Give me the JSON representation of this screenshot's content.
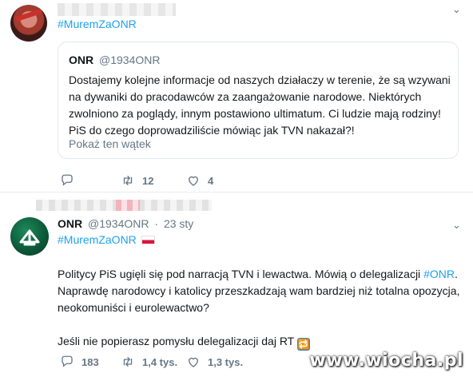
{
  "top_tweet": {
    "hashtag": "#MuremZaONR",
    "chevron": "⌄",
    "quote": {
      "name": "ONR",
      "handle": "@1934ONR",
      "text": "Dostajemy kolejne informacje od naszych działaczy w terenie, że są wzywani na dywaniki do pracodawców za zaangażowanie narodowe. Niektórych zwolniono za poglądy, innym postawiono ultimatum. Ci ludzie mają rodziny! PiS do czego doprowadziliście mówiąc jak TVN nakazał?!",
      "show_thread": "Pokaż ten wątek"
    },
    "actions": {
      "retweets": "12",
      "likes": "4"
    }
  },
  "second_tweet": {
    "name": "ONR",
    "handle": "@1934ONR",
    "sep": "·",
    "date": "23 sty",
    "chevron": "⌄",
    "hashtag": "#MuremZaONR",
    "text": {
      "p1_before": "Politycy PiS ugięli się pod narracją TVN i lewactwa. Mówią o delegalizacji ",
      "p1_link": "#ONR",
      "p1_after": ". Naprawdę narodowcy i katolicy przeszkadzają wam bardziej niż totalna opozycja, neokomuniści i eurolewactwo?",
      "p2": "Jeśli nie popierasz pomysłu delegalizacji daj RT",
      "rt_emoji": "🔁"
    },
    "actions": {
      "replies": "183",
      "retweets": "1,4 tys.",
      "likes": "1,3 tys."
    }
  },
  "watermark": "www.wiocha.pl",
  "colors": {
    "link": "#1da1f2",
    "muted": "#657786",
    "border": "#e1e8ed"
  }
}
